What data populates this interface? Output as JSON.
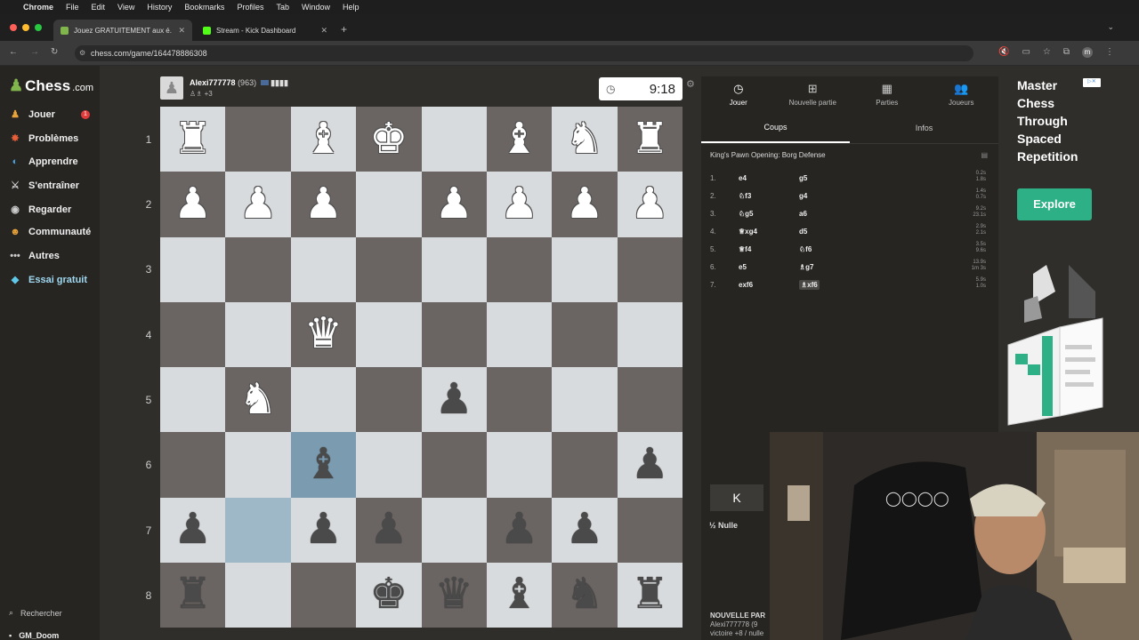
{
  "menubar": {
    "app": "Chrome",
    "items": [
      "File",
      "Edit",
      "View",
      "History",
      "Bookmarks",
      "Profiles",
      "Tab",
      "Window",
      "Help"
    ]
  },
  "tabs": [
    {
      "label": "Jouez GRATUITEMENT aux é..."
    },
    {
      "label": "Stream - Kick Dashboard"
    }
  ],
  "url": "chess.com/game/164478886308",
  "sidebar": {
    "logo": "Chess",
    "logo_suffix": ".com",
    "items": [
      {
        "label": "Jouer",
        "icon": "play-icon"
      },
      {
        "label": "Problèmes",
        "icon": "puzzle-icon"
      },
      {
        "label": "Apprendre",
        "icon": "learn-icon"
      },
      {
        "label": "S'entraîner",
        "icon": "train-icon"
      },
      {
        "label": "Regarder",
        "icon": "watch-icon"
      },
      {
        "label": "Communauté",
        "icon": "community-icon"
      },
      {
        "label": "Autres",
        "icon": "more-icon"
      },
      {
        "label": "Essai gratuit",
        "icon": "diamond-icon"
      }
    ],
    "badge": "1",
    "search": "Rechercher",
    "user": "GM_Doom"
  },
  "player_top": {
    "name": "Alexi777778",
    "rating": "(963)",
    "captures": "+3"
  },
  "clock": "9:18",
  "ranks": [
    "1",
    "2",
    "3",
    "4",
    "5",
    "6",
    "7",
    "8"
  ],
  "board": [
    [
      "wR",
      "",
      "wB",
      "wK",
      "",
      "wB",
      "wN",
      "wR"
    ],
    [
      "wP",
      "wP",
      "wP",
      "",
      "wP",
      "wP",
      "wP",
      "wP"
    ],
    [
      "",
      "",
      "",
      "",
      "",
      "",
      "",
      ""
    ],
    [
      "",
      "",
      "wQ",
      "",
      "",
      "",
      "",
      ""
    ],
    [
      "",
      "wN",
      "",
      "",
      "bP",
      "",
      "",
      ""
    ],
    [
      "",
      "",
      "bB",
      "",
      "",
      "",
      "",
      "bP"
    ],
    [
      "bP",
      "",
      "bP",
      "bP",
      "",
      "bP",
      "bP",
      ""
    ],
    [
      "bR",
      "",
      "",
      "bK",
      "bQ",
      "bB",
      "bN",
      "bR"
    ]
  ],
  "panel": {
    "tabs": [
      {
        "label": "Jouer",
        "icon": "clock-icon"
      },
      {
        "label": "Nouvelle partie",
        "icon": "plus-icon"
      },
      {
        "label": "Parties",
        "icon": "board-icon"
      },
      {
        "label": "Joueurs",
        "icon": "players-icon"
      }
    ],
    "subtabs": [
      "Coups",
      "Infos"
    ],
    "opening": "King's Pawn Opening: Borg Defense",
    "moves": [
      {
        "num": "1.",
        "w": "e4",
        "b": "g5",
        "t1": "0.2s",
        "t2": "1.8s"
      },
      {
        "num": "2.",
        "w": "♘f3",
        "b": "g4",
        "t1": "1.4s",
        "t2": "0.7s"
      },
      {
        "num": "3.",
        "w": "♘g5",
        "b": "a6",
        "t1": "9.2s",
        "t2": "23.1s"
      },
      {
        "num": "4.",
        "w": "♕xg4",
        "b": "d5",
        "t1": "2.9s",
        "t2": "2.1s"
      },
      {
        "num": "5.",
        "w": "♕f4",
        "b": "♘f6",
        "t1": "3.5s",
        "t2": "9.6s"
      },
      {
        "num": "6.",
        "w": "e5",
        "b": "♗g7",
        "t1": "13.9s",
        "t2": "1m 3s"
      },
      {
        "num": "7.",
        "w": "exf6",
        "b": "♗xf6",
        "t1": "5.9s",
        "t2": "1.0s"
      }
    ],
    "draw": "Nulle",
    "draw_prefix": "½",
    "first": "K",
    "newgame": "NOUVELLE PAR",
    "newgame_sub1": "Alexi777778 (9",
    "newgame_sub2": "victoire +8 / nulle"
  },
  "ad": {
    "title": "Master Chess Through Spaced Repetition",
    "button": "Explore"
  }
}
